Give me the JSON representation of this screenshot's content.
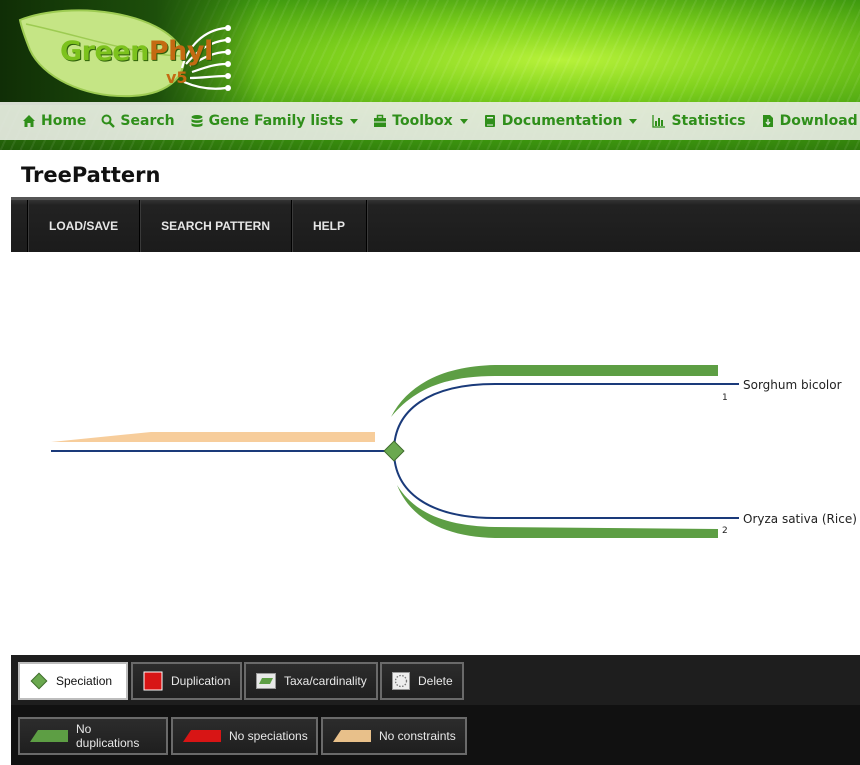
{
  "header": {
    "logo": {
      "brand_part1": "Green",
      "brand_part2": "Phyl",
      "version": "v5"
    },
    "nav": [
      {
        "label": "Home",
        "icon": "home-icon",
        "dropdown": false
      },
      {
        "label": "Search",
        "icon": "search-icon",
        "dropdown": false
      },
      {
        "label": "Gene Family lists",
        "icon": "database-icon",
        "dropdown": true
      },
      {
        "label": "Toolbox",
        "icon": "toolbox-icon",
        "dropdown": true
      },
      {
        "label": "Documentation",
        "icon": "book-icon",
        "dropdown": true
      },
      {
        "label": "Statistics",
        "icon": "bar-chart-icon",
        "dropdown": false
      },
      {
        "label": "Download",
        "icon": "file-download-icon",
        "dropdown": false
      }
    ],
    "accent_color": "#2f8f1a"
  },
  "page": {
    "title": "TreePattern"
  },
  "toolbar": {
    "load_save": "LOAD/SAVE",
    "search_pattern": "SEARCH PATTERN",
    "help": "HELP"
  },
  "tree": {
    "leaves": [
      {
        "name": "Sorghum bicolor",
        "count": "1"
      },
      {
        "name": "Oryza sativa (Rice)",
        "count": "2"
      }
    ],
    "colors": {
      "branch": "#1a3a7a",
      "no_duplications": "#5d9e44",
      "no_constraints": "#f7cd9b",
      "speciation": "#6aa84f"
    }
  },
  "node_tools": {
    "speciation": "Speciation",
    "duplication": "Duplication",
    "taxa_cardinality": "Taxa/cardinality",
    "delete": "Delete"
  },
  "constraint_tools": {
    "no_duplications": "No duplications",
    "no_speciations": "No speciations",
    "no_constraints": "No constraints"
  }
}
